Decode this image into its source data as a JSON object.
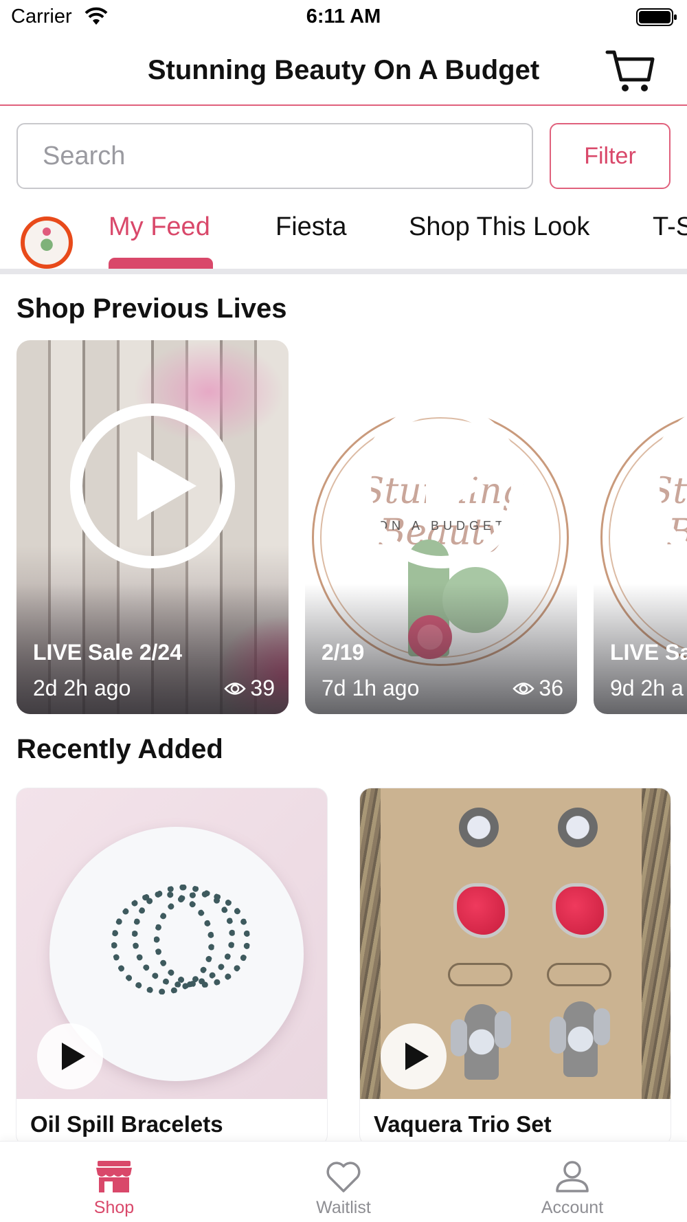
{
  "status_bar": {
    "carrier": "Carrier",
    "time": "6:11 AM"
  },
  "header": {
    "title": "Stunning Beauty On A Budget",
    "cart_icon": "cart-icon"
  },
  "search": {
    "placeholder": "Search",
    "value": ""
  },
  "filter": {
    "label": "Filter"
  },
  "tabs": [
    {
      "label": "My Feed",
      "active": true
    },
    {
      "label": "Fiesta",
      "active": false
    },
    {
      "label": "Shop This Look",
      "active": false
    },
    {
      "label": "T-S",
      "active": false
    }
  ],
  "sections": {
    "previous_lives": "Shop Previous Lives",
    "recently_added": "Recently Added"
  },
  "lives": [
    {
      "title": "LIVE Sale 2/24",
      "time": "2d 2h ago",
      "views": "39"
    },
    {
      "title": "2/19",
      "time": "7d 1h ago",
      "views": "36"
    },
    {
      "title": "LIVE Sa",
      "time": "9d 2h a",
      "views": ""
    }
  ],
  "logo_text": {
    "word": "Stunning Beauty",
    "sub": "ON A BUDGET"
  },
  "products": [
    {
      "name": "Oil Spill Bracelets"
    },
    {
      "name": "Vaquera Trio Set"
    }
  ],
  "bottom_nav": [
    {
      "label": "Shop",
      "icon": "shop-icon",
      "active": true
    },
    {
      "label": "Waitlist",
      "icon": "heart-icon",
      "active": false
    },
    {
      "label": "Account",
      "icon": "person-icon",
      "active": false
    }
  ],
  "colors": {
    "accent": "#d9486a",
    "divider": "#e0607c",
    "inactive": "#8e8e93"
  }
}
